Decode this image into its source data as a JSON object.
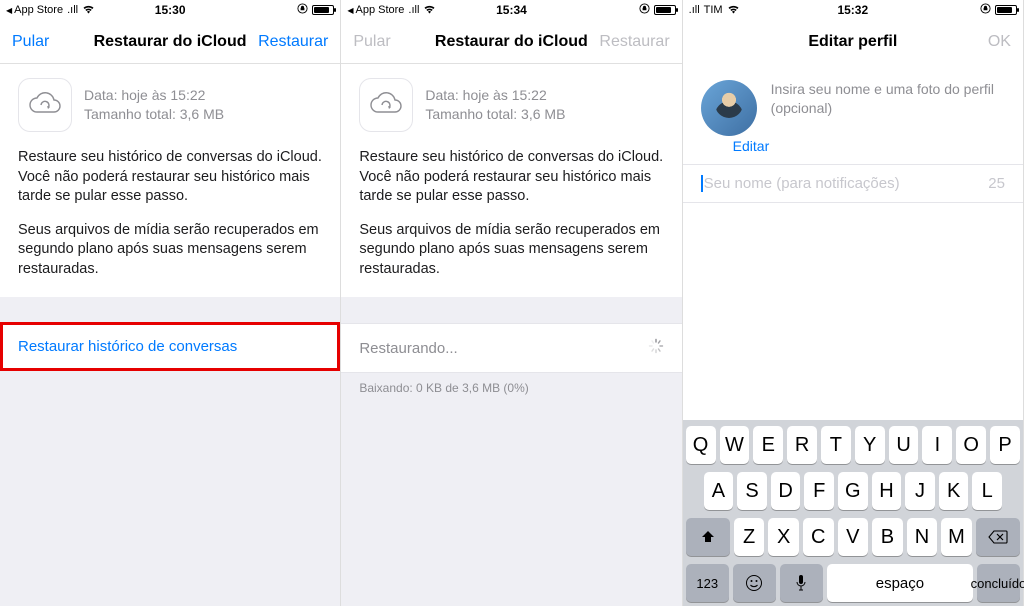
{
  "screens": [
    {
      "status": {
        "back_label": "App Store",
        "time": "15:30"
      },
      "nav": {
        "left": "Pular",
        "title": "Restaurar do iCloud",
        "right": "Restaurar",
        "left_enabled": true,
        "right_enabled": true
      },
      "backup": {
        "date_line": "Data: hoje às 15:22",
        "size_line": "Tamanho total: 3,6 MB",
        "para1": "Restaure seu histórico de conversas do iCloud. Você não poderá restaurar seu histórico mais tarde se pular esse passo.",
        "para2": "Seus arquivos de mídia serão recuperados em segundo plano após suas mensagens serem restauradas."
      },
      "action": {
        "label": "Restaurar histórico de conversas",
        "highlighted": true
      }
    },
    {
      "status": {
        "back_label": "App Store",
        "time": "15:34"
      },
      "nav": {
        "left": "Pular",
        "title": "Restaurar do iCloud",
        "right": "Restaurar",
        "left_enabled": false,
        "right_enabled": false
      },
      "backup": {
        "date_line": "Data: hoje às 15:22",
        "size_line": "Tamanho total: 3,6 MB",
        "para1": "Restaure seu histórico de conversas do iCloud. Você não poderá restaurar seu histórico mais tarde se pular esse passo.",
        "para2": "Seus arquivos de mídia serão recuperados em segundo plano após suas mensagens serem restauradas."
      },
      "action": {
        "label": "Restaurando...",
        "spinner": true
      },
      "footnote": "Baixando: 0 KB de 3,6 MB (0%)"
    },
    {
      "status": {
        "carrier": "TIM",
        "time": "15:32"
      },
      "nav": {
        "left": "",
        "title": "Editar perfil",
        "right": "OK",
        "right_enabled": false
      },
      "profile": {
        "prompt": "Insira seu nome e uma foto do perfil (opcional)",
        "edit": "Editar",
        "placeholder": "Seu nome (para notificações)",
        "max": "25"
      },
      "keyboard": {
        "row1": [
          "Q",
          "W",
          "E",
          "R",
          "T",
          "Y",
          "U",
          "I",
          "O",
          "P"
        ],
        "row2": [
          "A",
          "S",
          "D",
          "F",
          "G",
          "H",
          "J",
          "K",
          "L"
        ],
        "row3": [
          "Z",
          "X",
          "C",
          "V",
          "B",
          "N",
          "M"
        ],
        "num": "123",
        "space": "espaço",
        "return": "concluído"
      }
    }
  ]
}
